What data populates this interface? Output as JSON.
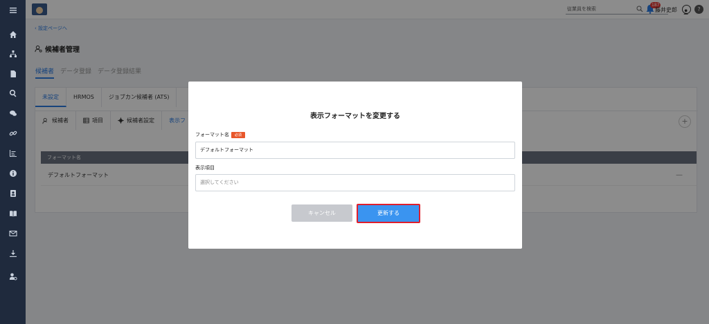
{
  "header": {
    "search_placeholder": "従業員を検索",
    "notification_count": "187",
    "user_name": "藤井史郎",
    "help_label": "?"
  },
  "sidebar": {
    "items": [
      {
        "icon": "menu-icon"
      },
      {
        "icon": "home-icon"
      },
      {
        "icon": "org-chart-icon"
      },
      {
        "icon": "document-icon"
      },
      {
        "icon": "search-icon"
      },
      {
        "icon": "chat-icon"
      },
      {
        "icon": "link-icon"
      },
      {
        "icon": "chart-icon"
      },
      {
        "icon": "info-icon"
      },
      {
        "icon": "contact-card-icon"
      },
      {
        "icon": "book-icon"
      },
      {
        "icon": "mail-icon"
      },
      {
        "icon": "download-icon"
      },
      {
        "icon": "user-settings-icon"
      }
    ]
  },
  "page": {
    "back_link": "‹ 設定ページへ",
    "title": "候補者管理",
    "main_tabs": [
      "候補者",
      "データ登録",
      "データ登録結果"
    ],
    "source_tabs": [
      "未設定",
      "HRMOS",
      "ジョブカン候補者 (ATS)"
    ],
    "sub_tabs": [
      "候補者",
      "項目",
      "候補者設定",
      "表示フ"
    ],
    "table_header": "フォーマット名",
    "table_row": "デフォルトフォーマット",
    "add_symbol": "+",
    "row_menu_symbol": "—"
  },
  "modal": {
    "title": "表示フォーマットを変更する",
    "field1_label": "フォーマット名",
    "required_badge": "必須",
    "field1_value": "デフォルトフォーマット",
    "field2_label": "表示項目",
    "field2_placeholder": "選択してください",
    "cancel_label": "キャンセル",
    "update_label": "更新する"
  },
  "colors": {
    "accent": "#3a94f0",
    "sidebar": "#1f2a3d",
    "highlight_border": "#e01e2b",
    "required": "#e8572b"
  }
}
